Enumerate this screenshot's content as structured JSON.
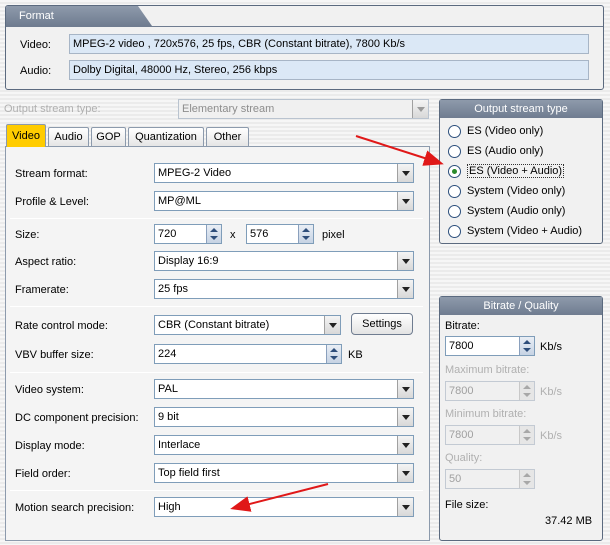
{
  "format": {
    "title": "Format",
    "video_label": "Video:",
    "video_value": "MPEG-2 video , 720x576, 25 fps, CBR (Constant bitrate), 7800 Kb/s",
    "audio_label": "Audio:",
    "audio_value": "Dolby Digital, 48000 Hz, Stereo, 256 kbps"
  },
  "output_stream_type": {
    "label": "Output stream type:",
    "value": "Elementary stream"
  },
  "tabs": [
    "Video",
    "Audio",
    "GOP",
    "Quantization",
    "Other"
  ],
  "video": {
    "stream_format_label": "Stream format:",
    "stream_format_value": "MPEG-2 Video",
    "profile_label": "Profile & Level:",
    "profile_value": "MP@ML",
    "size_label": "Size:",
    "width": "720",
    "x_label": "x",
    "height": "576",
    "pixel_label": "pixel",
    "aspect_label": "Aspect ratio:",
    "aspect_value": "Display 16:9",
    "framerate_label": "Framerate:",
    "framerate_value": "25 fps",
    "rate_control_label": "Rate control mode:",
    "rate_control_value": "CBR (Constant bitrate)",
    "settings_button": "Settings",
    "vbv_label": "VBV buffer size:",
    "vbv_value": "224",
    "vbv_unit": "KB",
    "video_system_label": "Video system:",
    "video_system_value": "PAL",
    "dc_label": "DC component precision:",
    "dc_value": "9 bit",
    "display_mode_label": "Display mode:",
    "display_mode_value": "Interlace",
    "field_order_label": "Field order:",
    "field_order_value": "Top field first",
    "motion_label": "Motion search precision:",
    "motion_value": "High"
  },
  "stream_type_panel": {
    "title": "Output stream type",
    "options": [
      "ES (Video only)",
      "ES (Audio only)",
      "ES (Video + Audio)",
      "System (Video only)",
      "System (Audio only)",
      "System (Video + Audio)"
    ],
    "selected_index": 2
  },
  "bitrate_panel": {
    "title": "Bitrate / Quality",
    "bitrate_label": "Bitrate:",
    "bitrate_value": "7800",
    "bitrate_unit": "Kb/s",
    "max_label": "Maximum bitrate:",
    "max_value": "7800",
    "max_unit": "Kb/s",
    "min_label": "Minimum bitrate:",
    "min_value": "7800",
    "min_unit": "Kb/s",
    "quality_label": "Quality:",
    "quality_value": "50",
    "file_size_label": "File size:",
    "file_size_value": "37.42 MB"
  },
  "colors": {
    "active_tab": "#ffcc00",
    "info_field_bg": "#dbe8f6",
    "header_bg": "#7a8699",
    "annotation_arrow": "#e01818"
  }
}
